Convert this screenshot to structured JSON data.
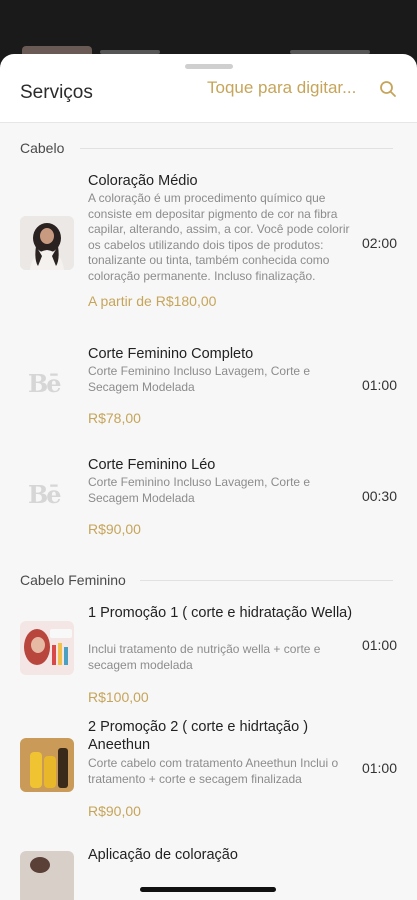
{
  "header": {
    "title": "Serviços",
    "search_placeholder": "Toque para digitar..."
  },
  "sections": [
    {
      "name": "Cabelo",
      "services": [
        {
          "name": "Coloração Médio",
          "description": "A coloração é um procedimento químico que consiste em depositar pigmento de cor na fibra capilar, alterando, assim, a cor. Você pode colorir os cabelos utilizando dois tipos de produtos: tonalizante ou tinta, também conhecida como coloração permanente. Incluso finalização.",
          "price": "A partir de R$180,00",
          "duration": "02:00",
          "thumb": "photo-woman"
        },
        {
          "name": "Corte Feminino Completo",
          "description": "Corte Feminino Incluso Lavagem, Corte e Secagem Modelada",
          "price": "R$78,00",
          "duration": "01:00",
          "thumb": "be-logo",
          "logo_text": "Bē"
        },
        {
          "name": "Corte Feminino Léo",
          "description": "Corte Feminino Incluso Lavagem, Corte e Secagem Modelada",
          "price": "R$90,00",
          "duration": "00:30",
          "thumb": "be-logo",
          "logo_text": "Bē"
        }
      ]
    },
    {
      "name": "Cabelo Feminino",
      "services": [
        {
          "name": "1 Promoção 1 ( corte e hidratação Wella)",
          "description": "Inclui tratamento de nutrição wella + corte e secagem modelada",
          "price": "R$100,00",
          "duration": "01:00",
          "thumb": "photo-wella"
        },
        {
          "name": "2 Promoção 2 ( corte e hidrtação ) Aneethun",
          "description": "Corte cabelo com tratamento Aneethun Inclui o tratamento + corte e secagem finalizada",
          "price": "R$90,00",
          "duration": "01:00",
          "thumb": "photo-aneethun"
        },
        {
          "name": "Aplicação de coloração",
          "description": "",
          "price": "",
          "duration": "",
          "thumb": "photo-color"
        }
      ]
    }
  ]
}
